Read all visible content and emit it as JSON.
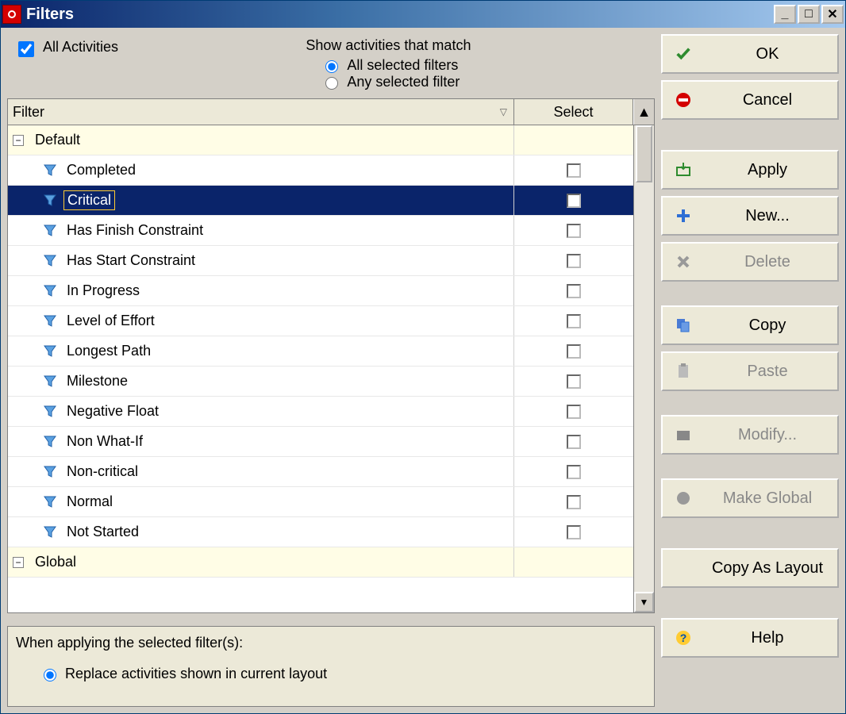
{
  "window": {
    "title": "Filters"
  },
  "topbar": {
    "allActivities": "All Activities",
    "matchLabel": "Show activities that match",
    "radioAll": "All selected filters",
    "radioAny": "Any selected filter"
  },
  "columns": {
    "filter": "Filter",
    "select": "Select"
  },
  "groups": [
    {
      "name": "Default",
      "expanded": true
    },
    {
      "name": "Global",
      "expanded": true
    }
  ],
  "filters": [
    {
      "name": "Completed",
      "selected": false,
      "highlighted": false
    },
    {
      "name": "Critical",
      "selected": false,
      "highlighted": true
    },
    {
      "name": "Has Finish Constraint",
      "selected": false,
      "highlighted": false
    },
    {
      "name": "Has Start Constraint",
      "selected": false,
      "highlighted": false
    },
    {
      "name": "In Progress",
      "selected": false,
      "highlighted": false
    },
    {
      "name": "Level of Effort",
      "selected": false,
      "highlighted": false
    },
    {
      "name": "Longest Path",
      "selected": false,
      "highlighted": false
    },
    {
      "name": "Milestone",
      "selected": false,
      "highlighted": false
    },
    {
      "name": "Negative Float",
      "selected": false,
      "highlighted": false
    },
    {
      "name": "Non What-If",
      "selected": false,
      "highlighted": false
    },
    {
      "name": "Non-critical",
      "selected": false,
      "highlighted": false
    },
    {
      "name": "Normal",
      "selected": false,
      "highlighted": false
    },
    {
      "name": "Not Started",
      "selected": false,
      "highlighted": false
    }
  ],
  "bottom": {
    "label": "When applying the selected filter(s):",
    "radioReplace": "Replace activities shown in current layout"
  },
  "buttons": {
    "ok": "OK",
    "cancel": "Cancel",
    "apply": "Apply",
    "new": "New...",
    "delete": "Delete",
    "copy": "Copy",
    "paste": "Paste",
    "modify": "Modify...",
    "makeGlobal": "Make Global",
    "copyAsLayout": "Copy As Layout",
    "help": "Help"
  }
}
